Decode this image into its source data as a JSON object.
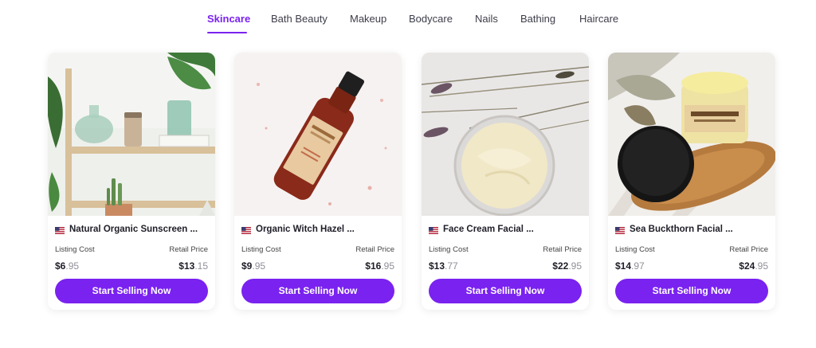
{
  "tabs": [
    {
      "label": "Skincare",
      "active": true
    },
    {
      "label": "Bath Beauty",
      "active": false
    },
    {
      "label": "Makeup",
      "active": false
    },
    {
      "label": "Bodycare",
      "active": false
    },
    {
      "label": "Nails",
      "active": false
    },
    {
      "label": "Bathing",
      "active": false
    },
    {
      "label": "Haircare",
      "active": false
    }
  ],
  "colors": {
    "accent": "#7a22f0",
    "text": "#1e1e28",
    "muted_cents": "#8f8f99"
  },
  "products": [
    {
      "flag": "us-flag-icon",
      "title": "Natural Organic Sunscreen ...",
      "listing_label": "Listing Cost",
      "listing_dollars": "$6",
      "listing_cents": ".95",
      "retail_label": "Retail Price",
      "retail_dollars": "$13",
      "retail_cents": ".15",
      "button": "Start Selling Now"
    },
    {
      "flag": "us-flag-icon",
      "title": "Organic Witch Hazel ...",
      "listing_label": "Listing Cost",
      "listing_dollars": "$9",
      "listing_cents": ".95",
      "retail_label": "Retail Price",
      "retail_dollars": "$16",
      "retail_cents": ".95",
      "button": "Start Selling Now"
    },
    {
      "flag": "us-flag-icon",
      "title": "Face Cream Facial ...",
      "listing_label": "Listing Cost",
      "listing_dollars": "$13",
      "listing_cents": ".77",
      "retail_label": "Retail Price",
      "retail_dollars": "$22",
      "retail_cents": ".95",
      "button": "Start Selling Now"
    },
    {
      "flag": "us-flag-icon",
      "title": "Sea Buckthorn Facial ...",
      "listing_label": "Listing Cost",
      "listing_dollars": "$14",
      "listing_cents": ".97",
      "retail_label": "Retail Price",
      "retail_dollars": "$24",
      "retail_cents": ".95",
      "button": "Start Selling Now"
    }
  ]
}
